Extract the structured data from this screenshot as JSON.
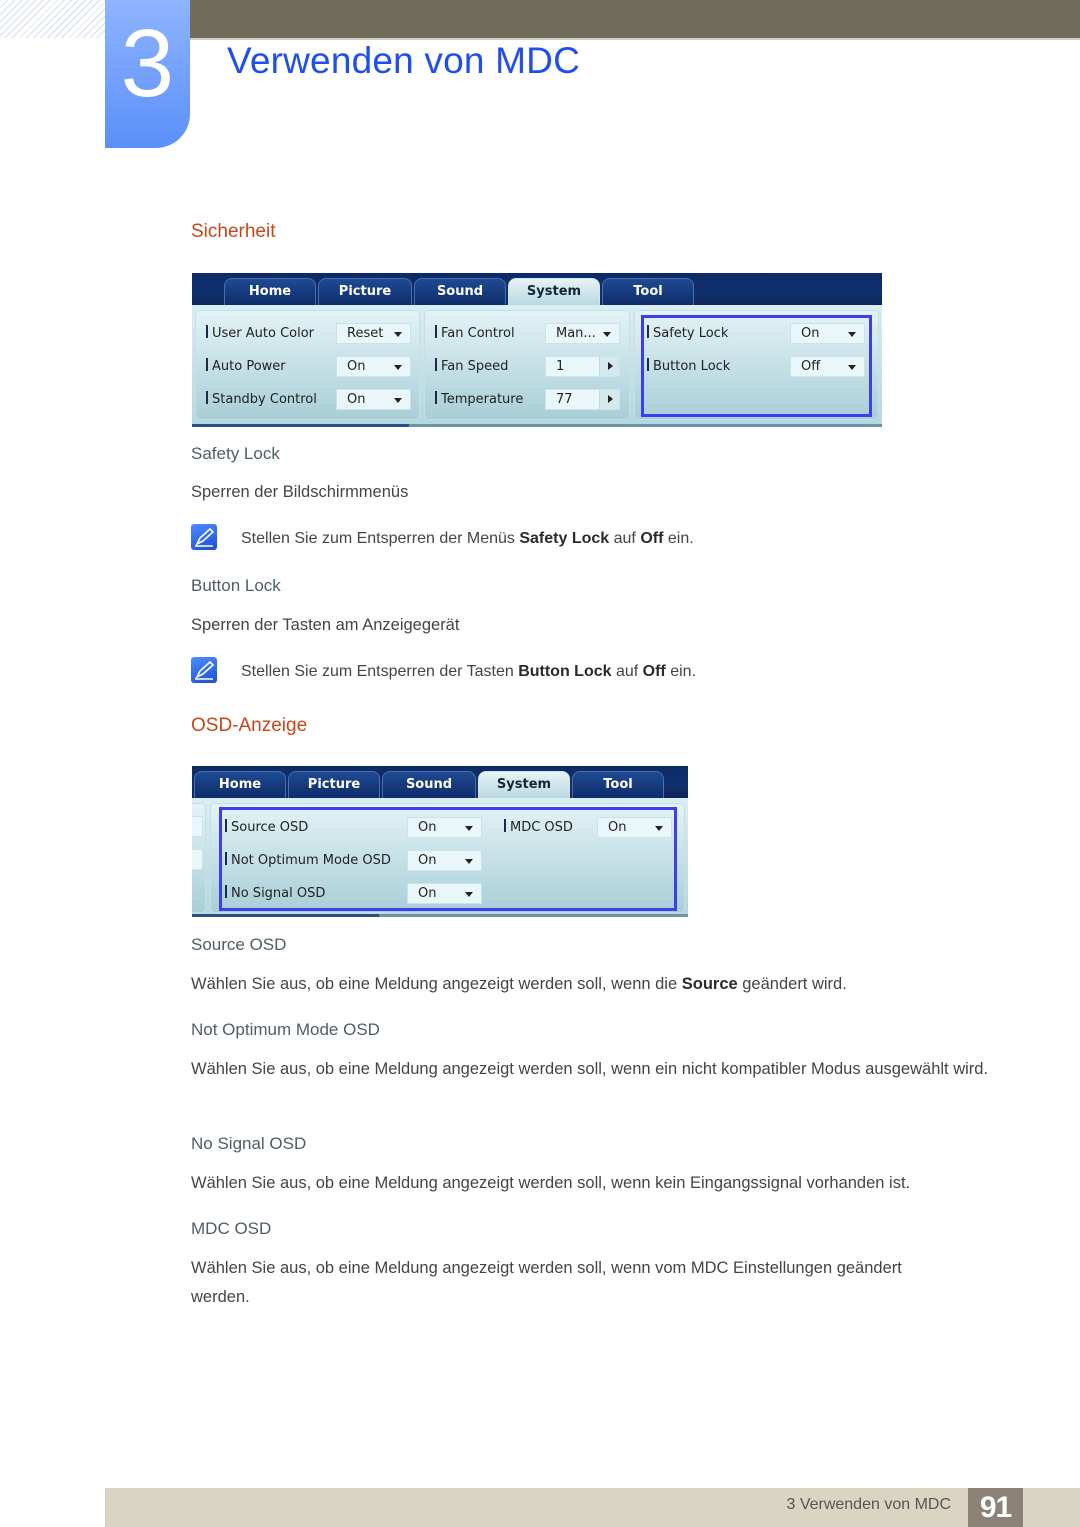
{
  "header": {
    "chapter_number": "3",
    "chapter_title": "Verwenden von MDC"
  },
  "sections": {
    "security": {
      "heading": "Sicherheit",
      "screenshot": {
        "tabs": [
          "Home",
          "Picture",
          "Sound",
          "System",
          "Tool"
        ],
        "active_tab": "System",
        "groups": [
          {
            "rows": [
              {
                "label": "User Auto Color",
                "value": "Reset",
                "control": "dropdown"
              },
              {
                "label": "Auto Power",
                "value": "On",
                "control": "dropdown"
              },
              {
                "label": "Standby Control",
                "value": "On",
                "control": "dropdown"
              }
            ]
          },
          {
            "rows": [
              {
                "label": "Fan Control",
                "value": "Man...",
                "control": "dropdown"
              },
              {
                "label": "Fan Speed",
                "value": "1",
                "control": "stepper"
              },
              {
                "label": "Temperature",
                "value": "77",
                "control": "stepper"
              }
            ]
          },
          {
            "highlighted": true,
            "rows": [
              {
                "label": "Safety Lock",
                "value": "On",
                "control": "dropdown"
              },
              {
                "label": "Button Lock",
                "value": "Off",
                "control": "dropdown"
              }
            ]
          }
        ]
      },
      "items": [
        {
          "title": "Safety Lock",
          "description": "Sperren der Bildschirmmenüs",
          "note": {
            "pre": "Stellen Sie zum Entsperren der Menüs ",
            "bold1": "Safety Lock",
            "mid": " auf ",
            "bold2": "Off",
            "post": " ein."
          }
        },
        {
          "title": "Button Lock",
          "description": "Sperren der Tasten am Anzeigegerät",
          "note": {
            "pre": "Stellen Sie zum Entsperren der Tasten ",
            "bold1": "Button Lock",
            "mid": " auf ",
            "bold2": "Off",
            "post": " ein."
          }
        }
      ]
    },
    "osd": {
      "heading": "OSD-Anzeige",
      "screenshot": {
        "tabs": [
          "Home",
          "Picture",
          "Sound",
          "System",
          "Tool"
        ],
        "active_tab": "System",
        "rows_left": [
          {
            "label": "Source OSD",
            "value": "On"
          },
          {
            "label": "Not Optimum Mode OSD",
            "value": "On"
          },
          {
            "label": "No Signal OSD",
            "value": "On"
          }
        ],
        "rows_right": [
          {
            "label": "MDC OSD",
            "value": "On"
          }
        ]
      },
      "items": [
        {
          "title": "Source OSD",
          "desc_pre": "Wählen Sie aus, ob eine Meldung angezeigt werden soll, wenn die ",
          "desc_bold": "Source",
          "desc_post": " geändert wird."
        },
        {
          "title": "Not Optimum Mode OSD",
          "description": "Wählen Sie aus, ob eine Meldung angezeigt werden soll, wenn ein nicht kompatibler Modus ausgewählt wird."
        },
        {
          "title": "No Signal OSD",
          "description": "Wählen Sie aus, ob eine Meldung angezeigt werden soll, wenn kein Eingangssignal vorhanden ist."
        },
        {
          "title": "MDC OSD",
          "description": "Wählen Sie aus, ob eine Meldung angezeigt werden soll, wenn vom MDC Einstellungen geändert werden."
        }
      ]
    }
  },
  "footer": {
    "chapter_label": "3 Verwenden von MDC",
    "page_number": "91"
  },
  "colors": {
    "chapter_blue": "#1f4ef0",
    "section_orange": "#c5471a",
    "highlight_border": "#3f3df0",
    "topbar": "#6f6c5a",
    "footer_bg": "#dad5c2",
    "page_badge": "#8d8276"
  }
}
